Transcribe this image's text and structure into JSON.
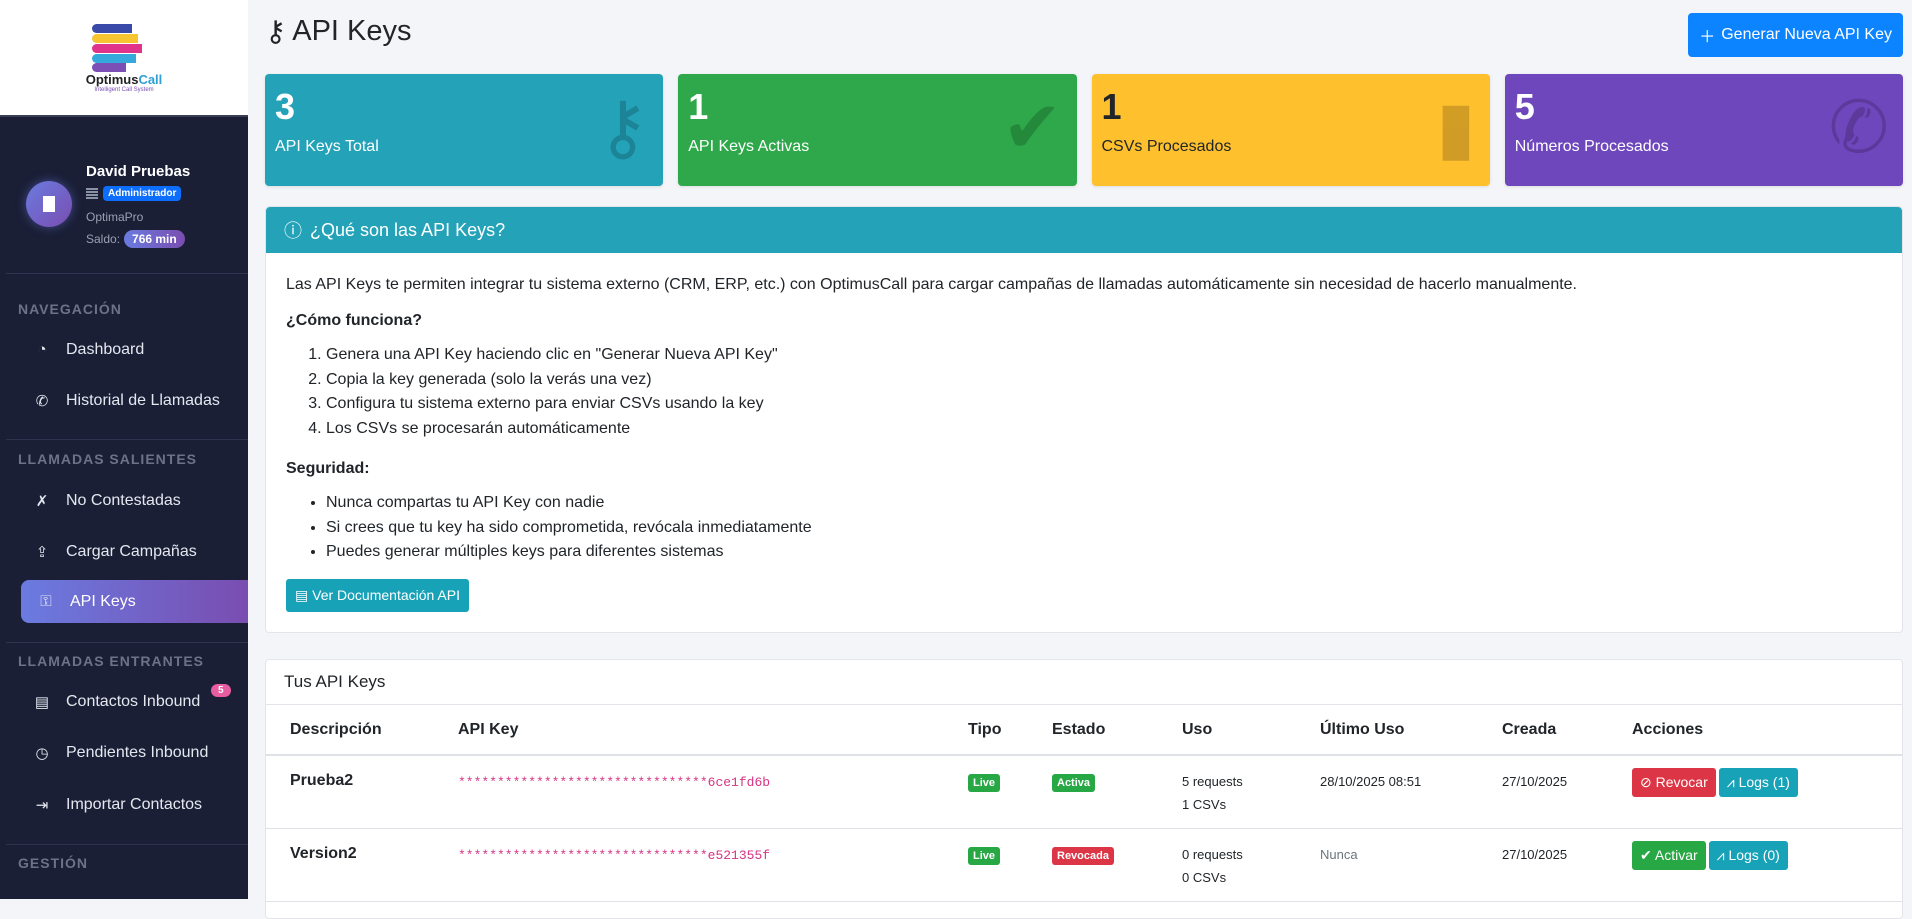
{
  "sidebar": {
    "logo": {
      "name_a": "Optimus",
      "name_b": "Call",
      "tagline": "Intelligent Call System"
    },
    "user": {
      "name": "David Pruebas",
      "role": "Administrador",
      "company": "OptimaPro",
      "saldo_label": "Saldo:",
      "saldo": "766 min"
    },
    "sections": [
      "NAVEGACIÓN",
      "LLAMADAS SALIENTES",
      "LLAMADAS ENTRANTES",
      "GESTIÓN"
    ],
    "items": [
      {
        "label": "Dashboard"
      },
      {
        "label": "Historial de Llamadas"
      },
      {
        "label": "No Contestadas"
      },
      {
        "label": "Cargar Campañas"
      },
      {
        "label": "API Keys"
      },
      {
        "label": "Contactos Inbound",
        "badge": "5"
      },
      {
        "label": "Pendientes Inbound"
      },
      {
        "label": "Importar Contactos"
      }
    ]
  },
  "header": {
    "title": "API Keys",
    "new_button": "Generar Nueva API Key"
  },
  "stats": [
    {
      "value": "3",
      "label": "API Keys Total",
      "color": "#23a2b8"
    },
    {
      "value": "1",
      "label": "API Keys Activas",
      "color": "#2ea84a"
    },
    {
      "value": "1",
      "label": "CSVs Procesados",
      "color": "#ffc02e"
    },
    {
      "value": "5",
      "label": "Números Procesados",
      "color": "#6f47bd"
    }
  ],
  "info": {
    "title": "¿Qué son las API Keys?",
    "intro": "Las API Keys te permiten integrar tu sistema externo (CRM, ERP, etc.) con OptimusCall para cargar campañas de llamadas automáticamente sin necesidad de hacerlo manualmente.",
    "how_title": "¿Cómo funciona?",
    "steps": [
      "Genera una API Key haciendo clic en \"Generar Nueva API Key\"",
      "Copia la key generada (solo la verás una vez)",
      "Configura tu sistema externo para enviar CSVs usando la key",
      "Los CSVs se procesarán automáticamente"
    ],
    "security_title": "Seguridad:",
    "security": [
      "Nunca compartas tu API Key con nadie",
      "Si crees que tu key ha sido comprometida, revócala inmediatamente",
      "Puedes generar múltiples keys para diferentes sistemas"
    ],
    "doc_button": "Ver Documentación API"
  },
  "table": {
    "title": "Tus API Keys",
    "columns": [
      "Descripción",
      "API Key",
      "Tipo",
      "Estado",
      "Uso",
      "Último Uso",
      "Creada",
      "Acciones"
    ],
    "rows": [
      {
        "desc": "Prueba2",
        "key": "********************************6ce1fd6b",
        "type": "Live",
        "status": "Activa",
        "requests": "5 requests",
        "csvs": "1 CSVs",
        "last": "28/10/2025 08:51",
        "created": "27/10/2025",
        "action": "Revocar",
        "logs": "Logs (1)"
      },
      {
        "desc": "Version2",
        "key": "********************************e521355f",
        "type": "Live",
        "status": "Revocada",
        "requests": "0 requests",
        "csvs": "0 CSVs",
        "last": "Nunca",
        "created": "27/10/2025",
        "action": "Activar",
        "logs": "Logs (0)"
      }
    ]
  }
}
